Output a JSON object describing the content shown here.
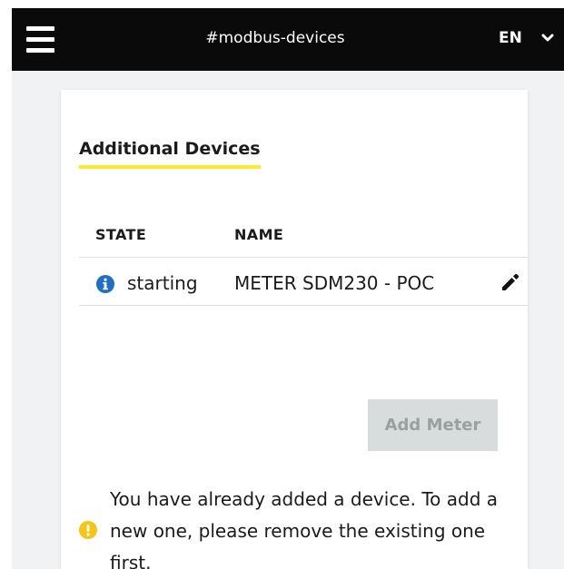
{
  "header": {
    "title": "#modbus-devices",
    "language": "EN"
  },
  "section": {
    "title": "Additional Devices"
  },
  "table": {
    "columns": [
      "STATE",
      "NAME"
    ],
    "rows": [
      {
        "state": "starting",
        "name": "METER SDM230 - POC"
      }
    ]
  },
  "actions": {
    "add_meter_label": "Add Meter"
  },
  "notice": {
    "text": "You have already added a device. To add a new one, please remove the existing one first."
  },
  "colors": {
    "topbar": "#0a0a0a",
    "accent_underline": "#fde92b",
    "info_icon": "#1f6fc4",
    "warning_icon": "#f5c518",
    "disabled_button_bg": "#d8dcdc"
  },
  "icons": {
    "menu": "hamburger-menu-icon",
    "language_dropdown": "chevron-down-icon",
    "state": "info-circle-icon",
    "edit": "pencil-icon",
    "notice": "warning-circle-icon"
  }
}
